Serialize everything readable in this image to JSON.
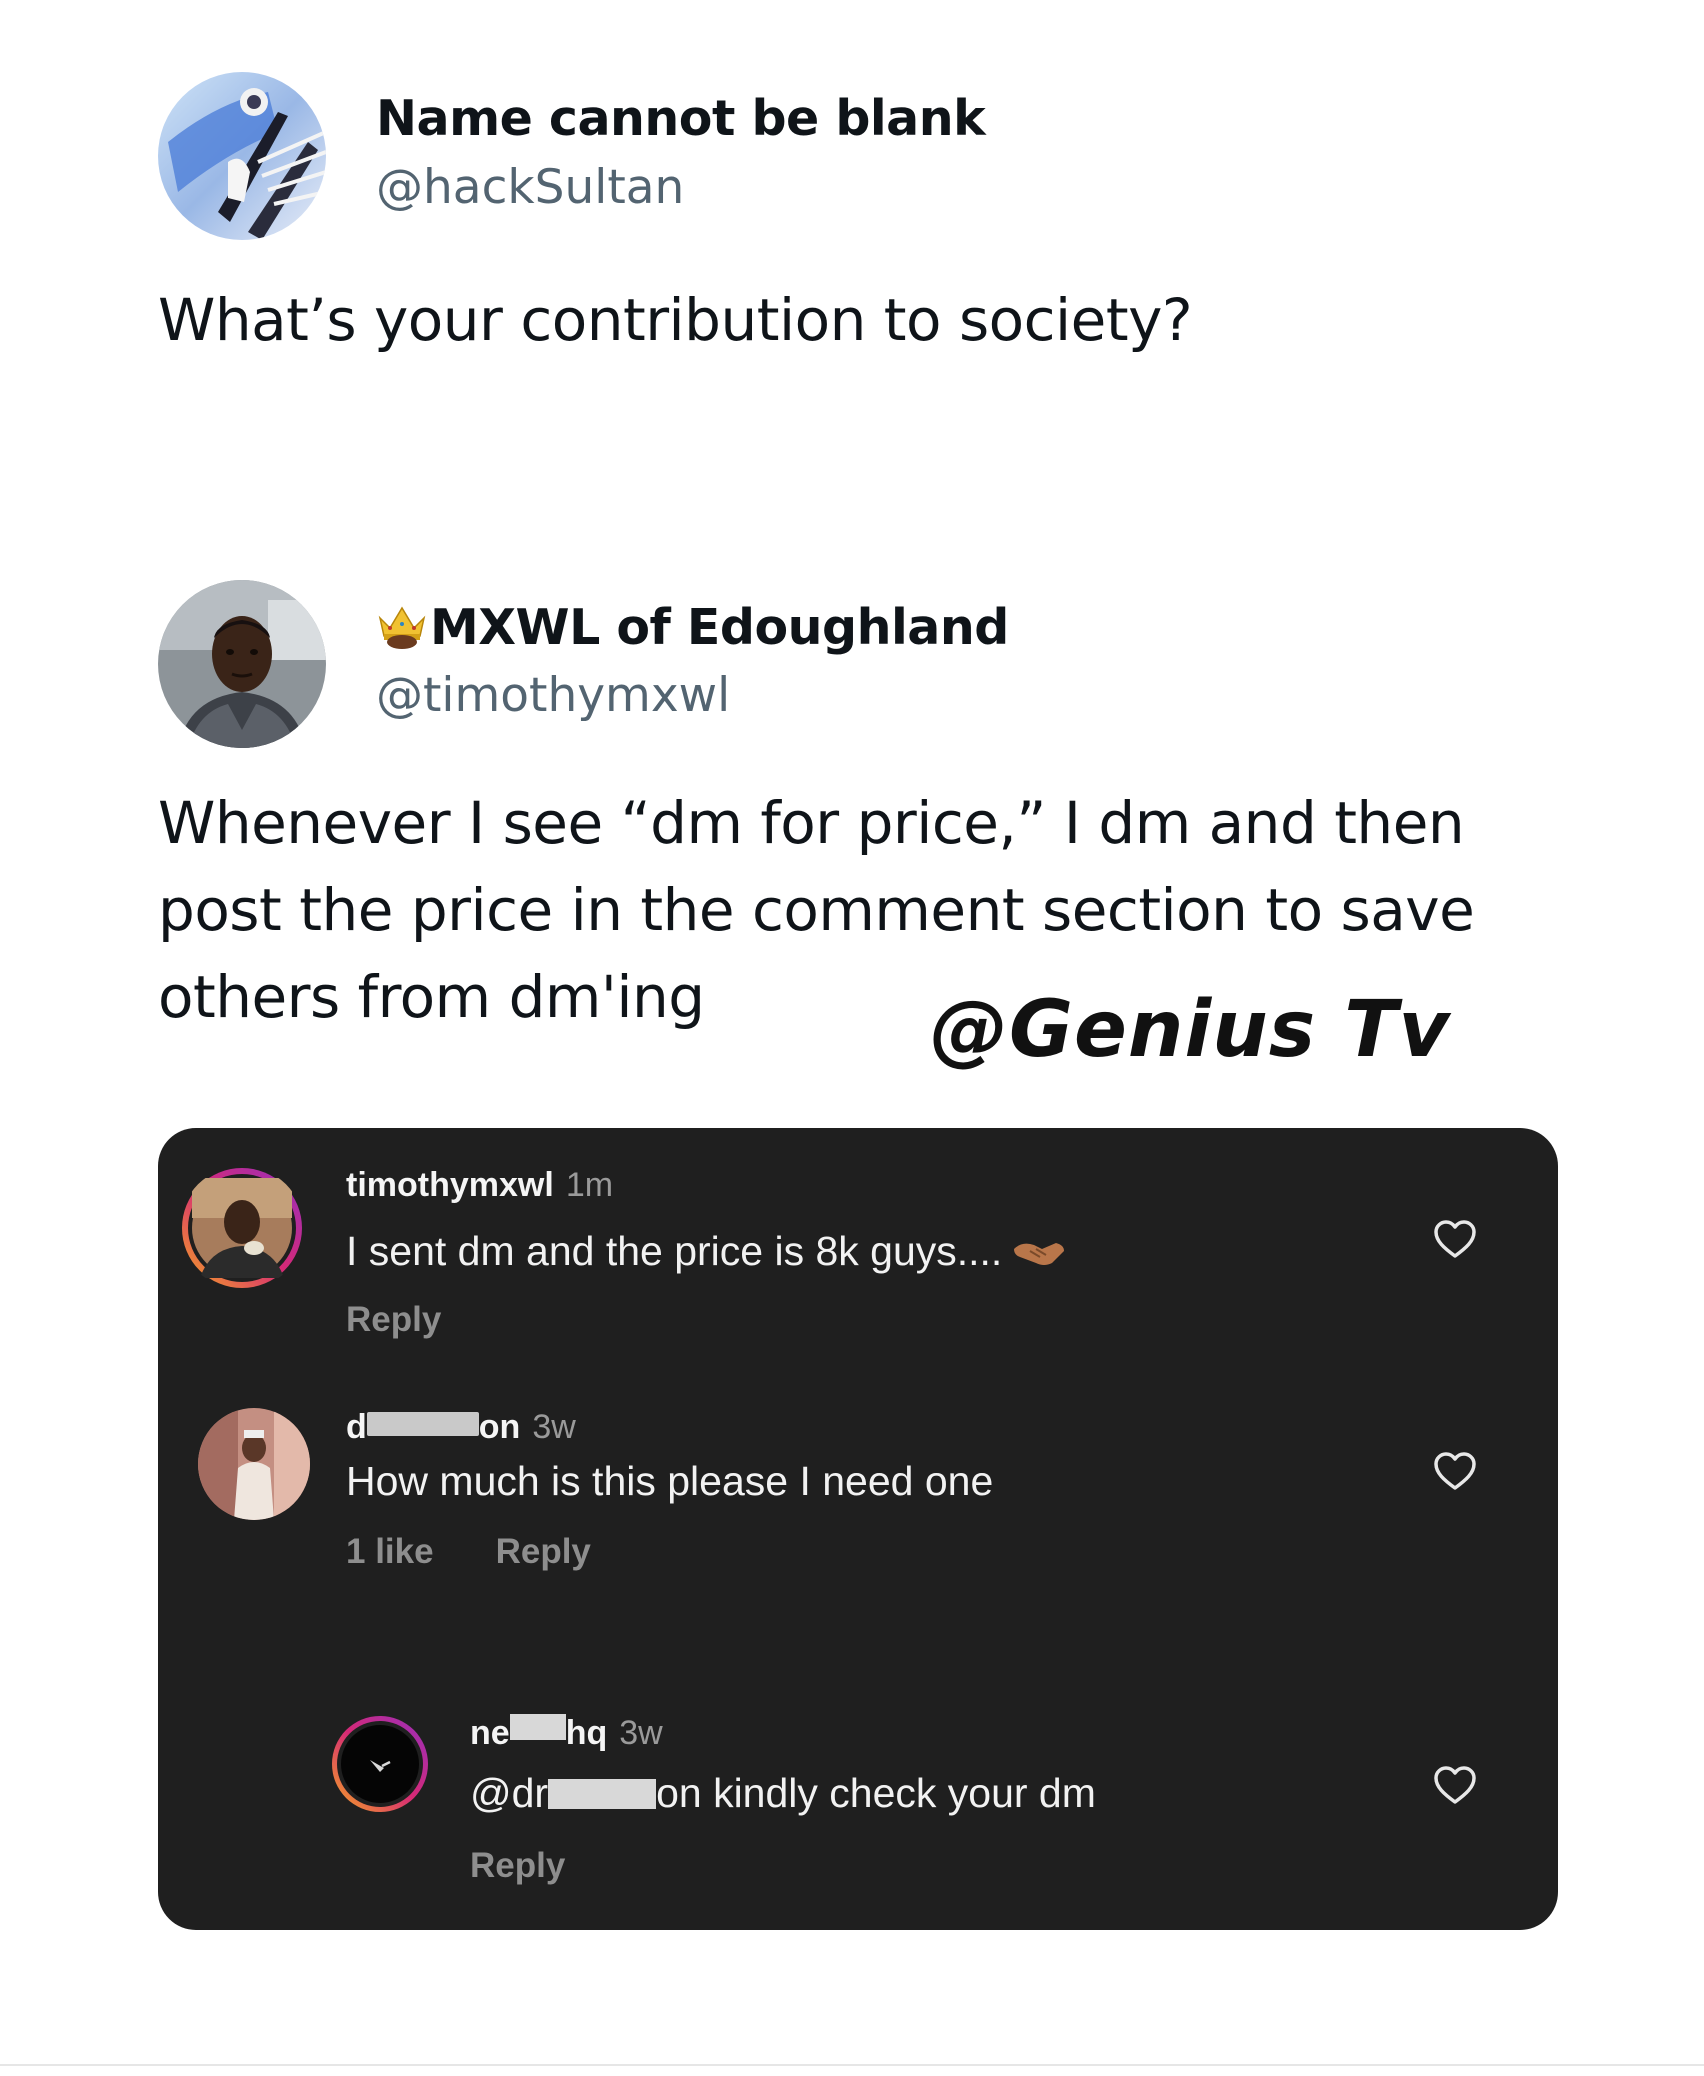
{
  "tweet1": {
    "display_name": "Name cannot be blank",
    "handle": "@hackSultan",
    "text": "What’s your contribution to society?"
  },
  "tweet2": {
    "display_name": "MXWL of Edoughland",
    "handle": "@timothymxwl",
    "text": "Whenever I see “dm for price,” I dm and then post the price in the comment section to save others from dm'ing"
  },
  "watermark": "@Genius Tv",
  "comments": {
    "c1": {
      "username": "timothymxwl",
      "time": "1m",
      "text": "I sent dm and the price is 8k guys....",
      "reply": "Reply"
    },
    "c2": {
      "username_start": "d",
      "username_end": "on",
      "time": "3w",
      "text": "How much is this please I need one",
      "likes": "1 like",
      "reply": "Reply"
    },
    "c3": {
      "username_start": "ne",
      "username_end": "hq",
      "time": "3w",
      "mention_start": "@dr",
      "mention_end": "on kindly check your dm",
      "reply": "Reply"
    }
  },
  "icons": {
    "heart": "heart-outline-icon",
    "crown": "crown-emoji-icon",
    "handshake": "handshake-emoji-icon"
  },
  "colors": {
    "card_background": "#1f1f1f",
    "handle_gray": "#536471",
    "muted_gray": "#8e8e8e"
  }
}
